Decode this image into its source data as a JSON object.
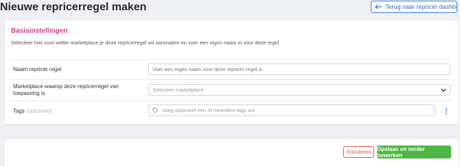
{
  "header": {
    "title": "Nieuwe repricerregel maken",
    "back_label": "Terug naar repricer dashboard"
  },
  "basis": {
    "section_title": "Basisinstellingen",
    "description": "Selecteer hier voor welke marketplace je deze repricerregel wil aanmaken en voer een eigen naam in voor deze regel.",
    "name_label": "Naam repricer regel",
    "name_placeholder": "Voer een eigen naam voor deze repricer regel in",
    "marketplace_label": "Marketplace waarop deze repricerregel van toepassing is",
    "marketplace_value": "Selecteer marketplace",
    "tags_label": "Tags",
    "tags_optional": "(optioneel)",
    "tags_placeholder": "Voeg optioneel één of meerdere tags toe"
  },
  "footer": {
    "cancel_label": "Annuleren",
    "save_label": "Opslaan en verder bewerken"
  },
  "colors": {
    "accent_blue": "#3b82d6",
    "section_pink": "#d23f8c",
    "save_green": "#4fb544",
    "cancel_red": "#d9534f"
  }
}
